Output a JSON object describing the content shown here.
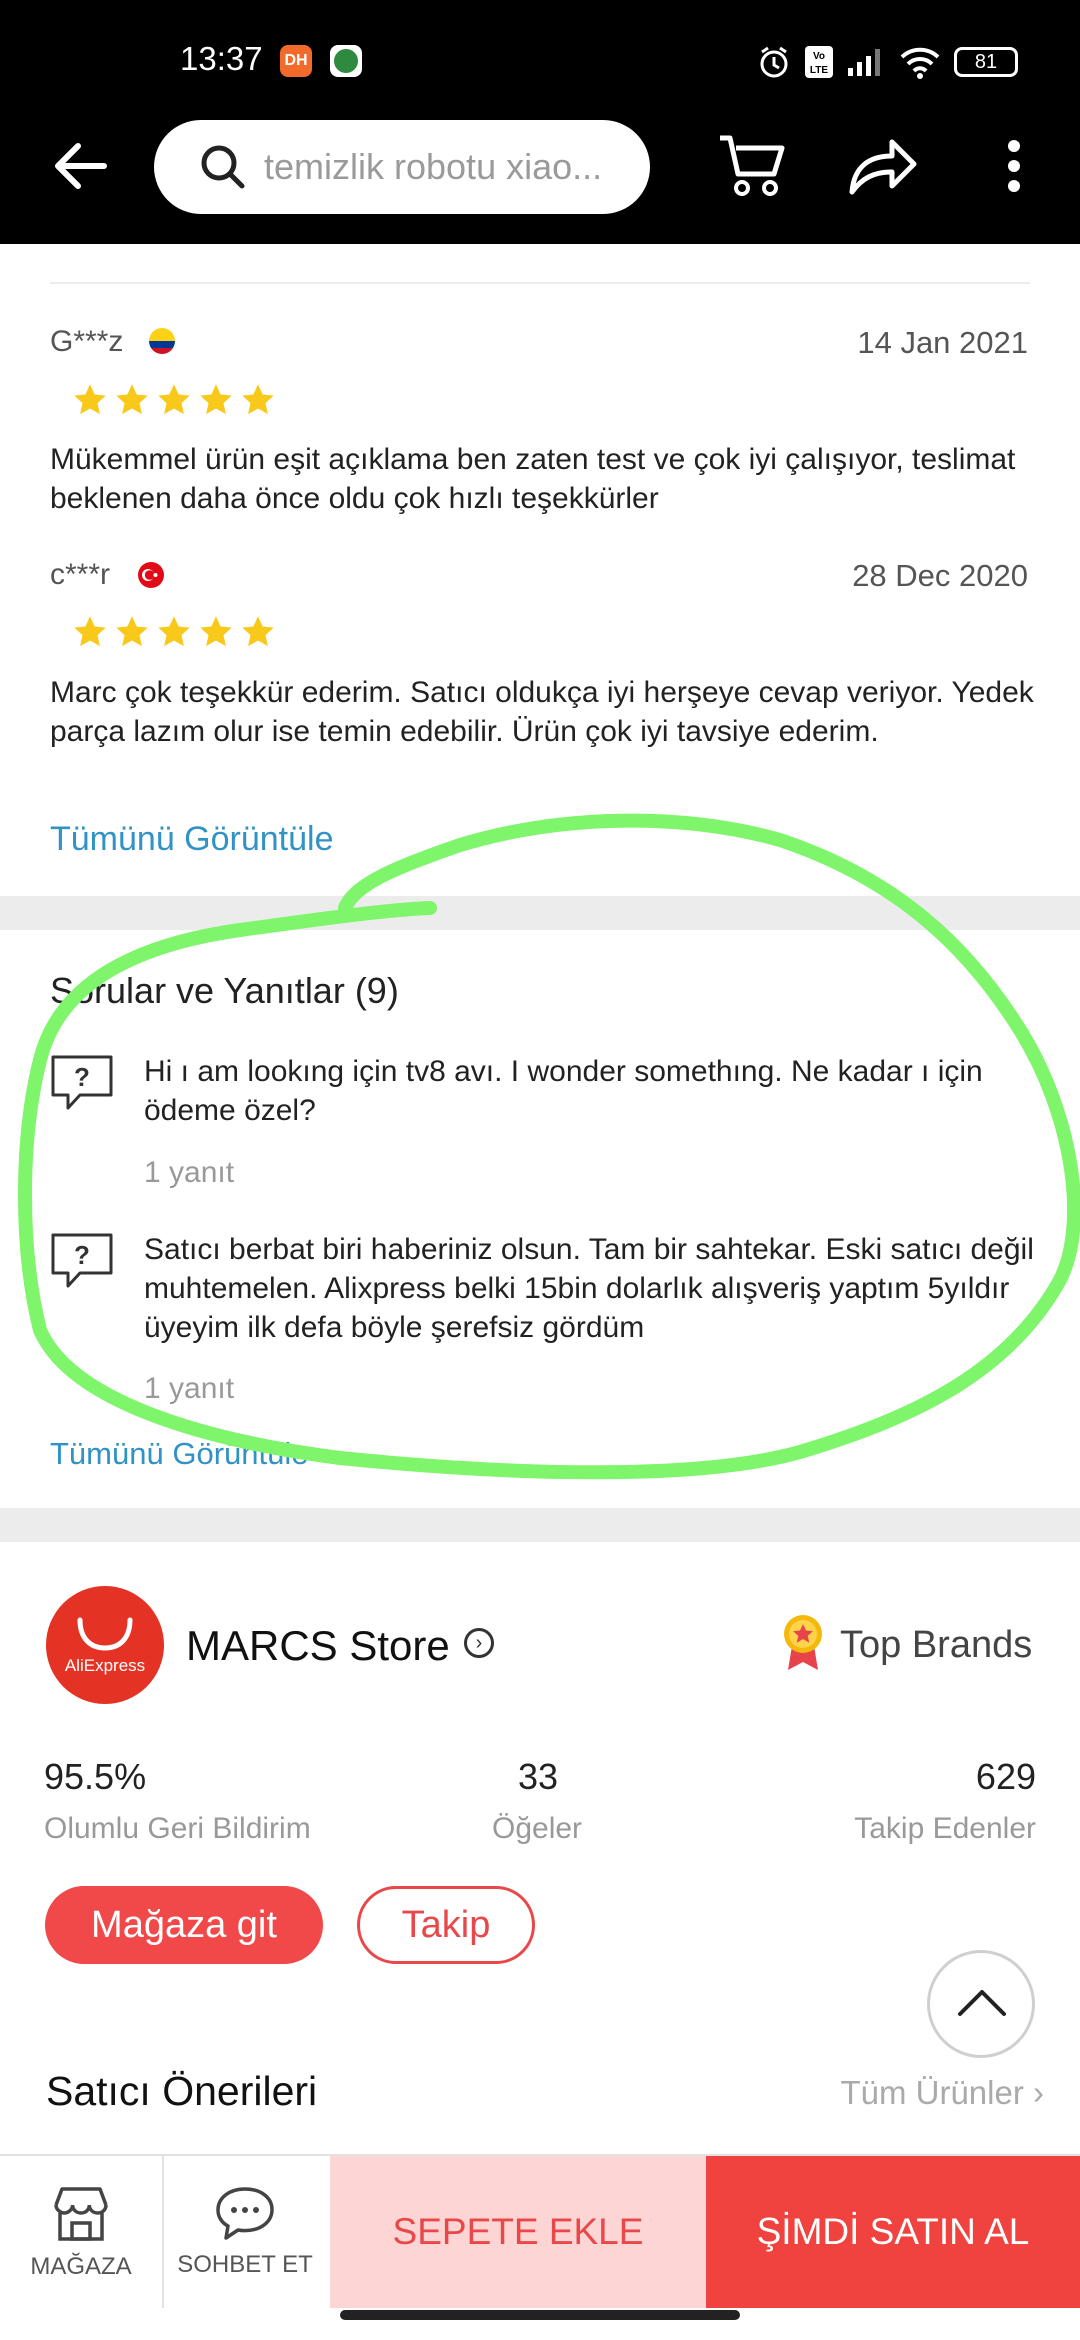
{
  "status_bar": {
    "time": "13:37",
    "app_badge": "DH",
    "battery": "81",
    "network_label": "Vo LTE"
  },
  "header": {
    "search_placeholder": "temizlik robotu xiao...",
    "icons": [
      "back-arrow-icon",
      "search-icon",
      "cart-icon",
      "share-icon",
      "more-vertical-icon"
    ]
  },
  "reviews": {
    "items": [
      {
        "name": "G***z",
        "flag": "colombia-flag-icon",
        "date": "14 Jan 2021",
        "stars": 5,
        "text": "Mükemmel ürün eşit açıklama ben zaten test ve çok iyi çalışıyor, teslimat beklenen daha önce oldu çok hızlı teşekkürler"
      },
      {
        "name": "c***r",
        "flag": "turkey-flag-icon",
        "date": "28 Dec 2020",
        "stars": 5,
        "text": "Marc çok teşekkür ederim.  Satıcı oldukça iyi herşeye cevap veriyor.  Yedek parça lazım olur ise temin edebilir.  Ürün çok iyi tavsiye ederim."
      }
    ],
    "view_all": "Tümünü Görüntüle"
  },
  "qa": {
    "title": "Sorular ve Yanıtlar (9)",
    "items": [
      {
        "question": "Hi ı am lookıng için tv8 avı. I wonder somethıng. Ne kadar ı için ödeme özel?",
        "answers": "1 yanıt"
      },
      {
        "question": "Satıcı berbat biri haberiniz olsun. Tam bir sahtekar. Eski satıcı değil muhtemelen. Alixpress belki 15bin dolarlık alışveriş yaptım 5yıldır üyeyim ilk defa böyle şerefsiz gördüm",
        "answers": "1 yanıt"
      }
    ],
    "view_all": "Tümünü Görüntüle"
  },
  "store": {
    "logo_text": "AliExpress",
    "name": "MARCS Store",
    "badge": "Top Brands",
    "stats": [
      {
        "value": "95.5%",
        "label": "Olumlu Geri Bildirim"
      },
      {
        "value": "33",
        "label": "Öğeler"
      },
      {
        "value": "629",
        "label": "Takip Edenler"
      }
    ],
    "go_store": "Mağaza git",
    "follow": "Takip"
  },
  "recommendations": {
    "title": "Satıcı Önerileri",
    "all_products": "Tüm Ürünler"
  },
  "bottom_bar": {
    "store_label": "MAĞAZA",
    "chat_label": "SOHBET ET",
    "add_to_cart": "SEPETE EKLE",
    "buy_now": "ŞİMDİ SATIN AL"
  },
  "colors": {
    "accent_red": "#f0433f",
    "light_red": "#fdd5d4",
    "link_blue": "#3192c5",
    "star_yellow": "#f8c91a",
    "annotation_green": "#7ef56b"
  }
}
